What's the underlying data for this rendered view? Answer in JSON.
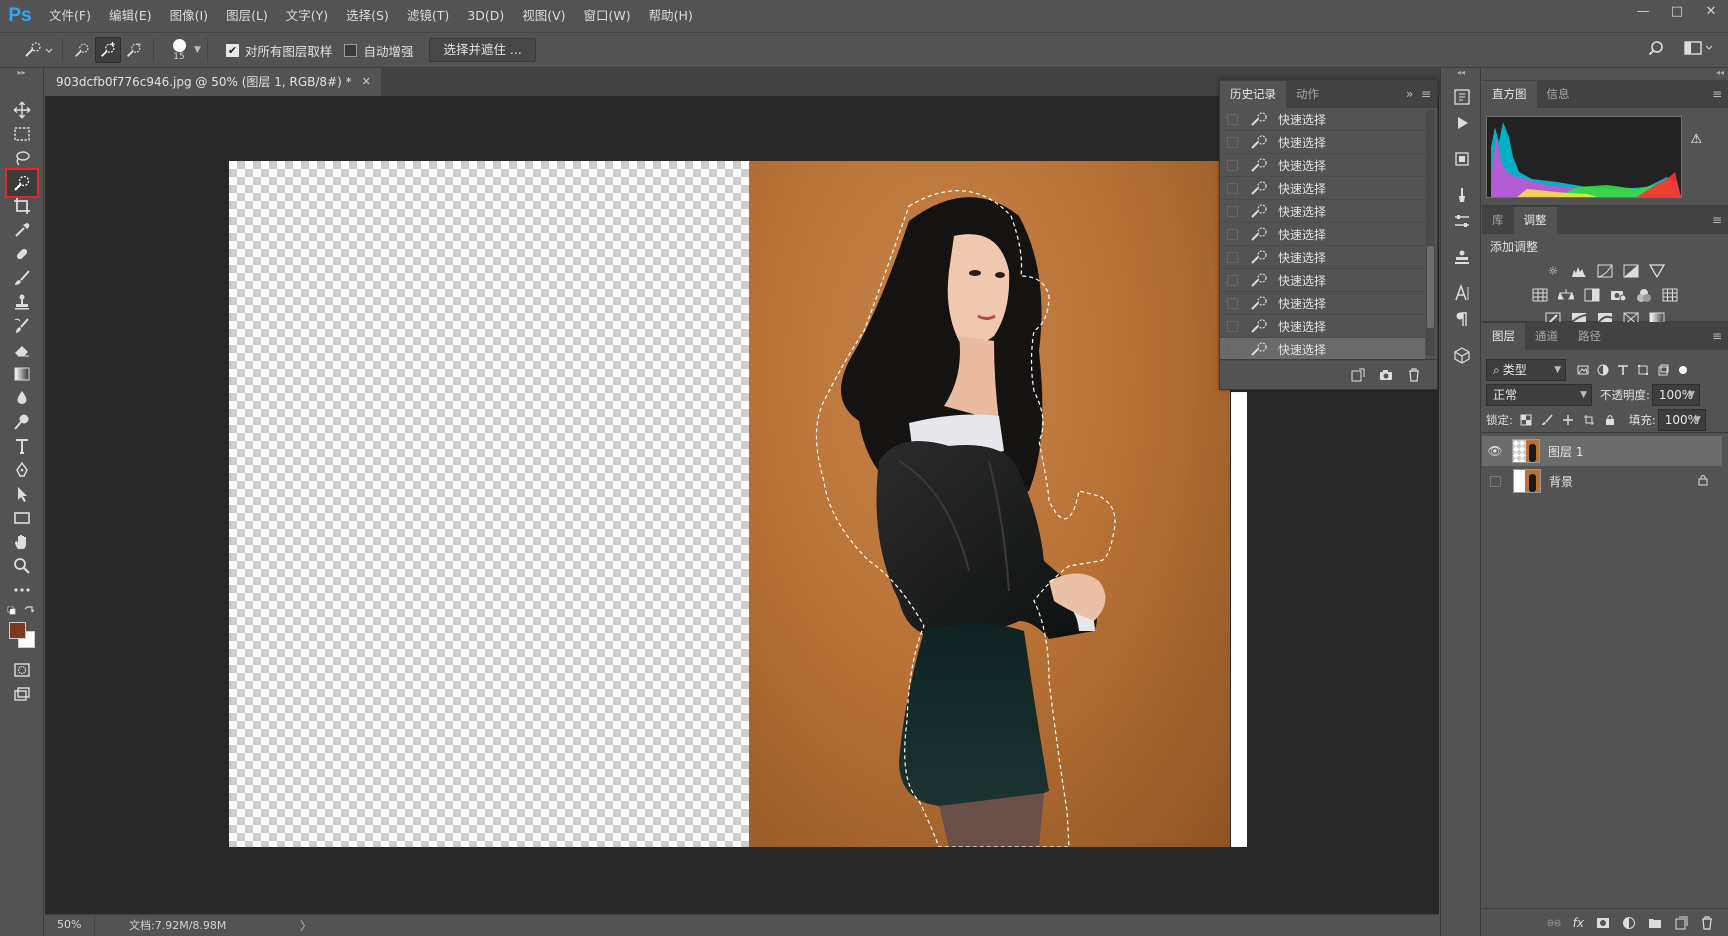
{
  "app": {
    "logo": "Ps"
  },
  "menu": [
    "文件(F)",
    "编辑(E)",
    "图像(I)",
    "图层(L)",
    "文字(Y)",
    "选择(S)",
    "滤镜(T)",
    "3D(D)",
    "视图(V)",
    "窗口(W)",
    "帮助(H)"
  ],
  "window_controls": {
    "minimize": "—",
    "restore": "□",
    "close": "✕"
  },
  "options": {
    "brush_size": "15",
    "sample_all_layers_label": "对所有图层取样",
    "sample_all_layers_checked": true,
    "auto_enhance_label": "自动增强",
    "auto_enhance_checked": false,
    "select_and_mask_label": "选择并遮住 ..."
  },
  "document": {
    "tab_title": "903dcfb0f776c946.jpg @ 50% (图层 1, RGB/8#) *",
    "close": "✕"
  },
  "status": {
    "zoom": "50%",
    "doc_info": "文档:7.92M/8.98M",
    "arrow": "〉"
  },
  "history_panel": {
    "tabs": [
      "历史记录",
      "动作"
    ],
    "items": [
      "快速选择",
      "快速选择",
      "快速选择",
      "快速选择",
      "快速选择",
      "快速选择",
      "快速选择",
      "快速选择",
      "快速选择",
      "快速选择",
      "快速选择"
    ],
    "active_index": 10
  },
  "histogram_panel": {
    "tabs": [
      "直方图",
      "信息"
    ]
  },
  "adjustments_panel": {
    "tabs": [
      "库",
      "调整"
    ],
    "title": "添加调整"
  },
  "layers_panel": {
    "tabs": [
      "图层",
      "通道",
      "路径"
    ],
    "filter_kind": "类型",
    "blend_mode": "正常",
    "opacity_label": "不透明度:",
    "opacity_value": "100%",
    "lock_label": "锁定:",
    "fill_label": "填充:",
    "fill_value": "100%",
    "layers": [
      {
        "name": "图层 1",
        "visible": true,
        "active": true
      },
      {
        "name": "背景",
        "visible": false,
        "active": false
      }
    ]
  },
  "colors": {
    "foreground": "#7b3a1e",
    "background": "#ffffff",
    "accent_ps": "#31a8ff",
    "highlight_border": "#e8242b"
  },
  "icons": {
    "toolbar": [
      "move-icon",
      "marquee-icon",
      "lasso-icon",
      "quick-selection-icon",
      "crop-icon",
      "eyedropper-icon",
      "healing-brush-icon",
      "brush-icon",
      "clone-stamp-icon",
      "history-brush-icon",
      "eraser-icon",
      "gradient-icon",
      "blur-icon",
      "dodge-icon",
      "type-icon",
      "pen-icon",
      "path-selection-icon",
      "rectangle-icon",
      "hand-icon",
      "zoom-icon",
      "more-tools-icon"
    ]
  }
}
